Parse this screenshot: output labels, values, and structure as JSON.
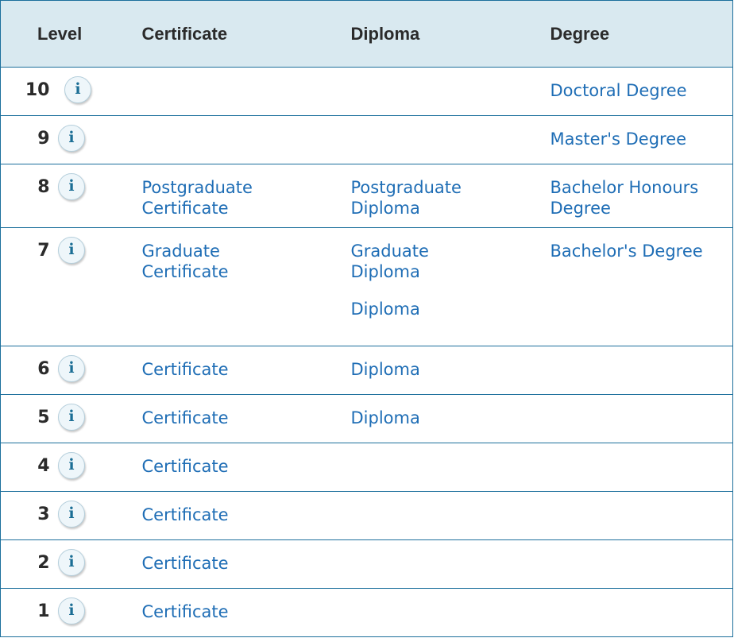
{
  "table": {
    "headers": {
      "level": "Level",
      "certificate": "Certificate",
      "diploma": "Diploma",
      "degree": "Degree"
    },
    "rows": [
      {
        "level": "10",
        "info_icon": "i",
        "certificate": [],
        "diploma": [],
        "degree": [
          "Doctoral Degree"
        ]
      },
      {
        "level": "9",
        "info_icon": "i",
        "certificate": [],
        "diploma": [],
        "degree": [
          "Master's Degree"
        ]
      },
      {
        "level": "8",
        "info_icon": "i",
        "certificate": [
          "Postgraduate Certificate"
        ],
        "diploma": [
          "Postgraduate Diploma"
        ],
        "degree": [
          "Bachelor Honours Degree"
        ]
      },
      {
        "level": "7",
        "info_icon": "i",
        "certificate": [
          "Graduate Certificate"
        ],
        "diploma": [
          "Graduate Diploma",
          "Diploma"
        ],
        "degree": [
          "Bachelor's Degree"
        ]
      },
      {
        "level": "6",
        "info_icon": "i",
        "certificate": [
          "Certificate"
        ],
        "diploma": [
          "Diploma"
        ],
        "degree": []
      },
      {
        "level": "5",
        "info_icon": "i",
        "certificate": [
          "Certificate"
        ],
        "diploma": [
          "Diploma"
        ],
        "degree": []
      },
      {
        "level": "4",
        "info_icon": "i",
        "certificate": [
          "Certificate"
        ],
        "diploma": [],
        "degree": []
      },
      {
        "level": "3",
        "info_icon": "i",
        "certificate": [
          "Certificate"
        ],
        "diploma": [],
        "degree": []
      },
      {
        "level": "2",
        "info_icon": "i",
        "certificate": [
          "Certificate"
        ],
        "diploma": [],
        "degree": []
      },
      {
        "level": "1",
        "info_icon": "i",
        "certificate": [
          "Certificate"
        ],
        "diploma": [],
        "degree": []
      }
    ]
  },
  "colors": {
    "header_bg": "#d9e9f0",
    "border": "#1c6f9c",
    "link": "#1e6db5",
    "text": "#2b2b2b",
    "info_icon": "#1b6e95"
  }
}
